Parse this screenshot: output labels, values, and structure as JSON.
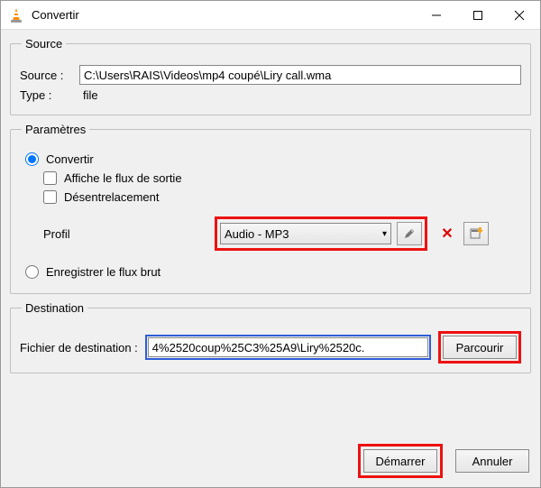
{
  "window": {
    "title": "Convertir"
  },
  "source": {
    "legend": "Source",
    "source_label": "Source :",
    "source_value": "C:\\Users\\RAIS\\Videos\\mp4 coupé\\Liry call.wma",
    "type_label": "Type :",
    "type_value": "file"
  },
  "params": {
    "legend": "Paramètres",
    "convert_label": "Convertir",
    "show_output_label": "Affiche le flux de sortie",
    "deinterlace_label": "Désentrelacement",
    "profil_label": "Profil",
    "profile_selected": "Audio - MP3",
    "save_raw_label": "Enregistrer le flux brut"
  },
  "destination": {
    "legend": "Destination",
    "file_label": "Fichier de destination :",
    "file_value": "4%2520coup%25C3%25A9\\Liry%2520c.",
    "browse_label": "Parcourir"
  },
  "footer": {
    "start_label": "Démarrer",
    "cancel_label": "Annuler"
  },
  "icons": {
    "wrench": "wrench-icon",
    "delete": "delete-icon",
    "new_profile": "new-profile-icon"
  }
}
